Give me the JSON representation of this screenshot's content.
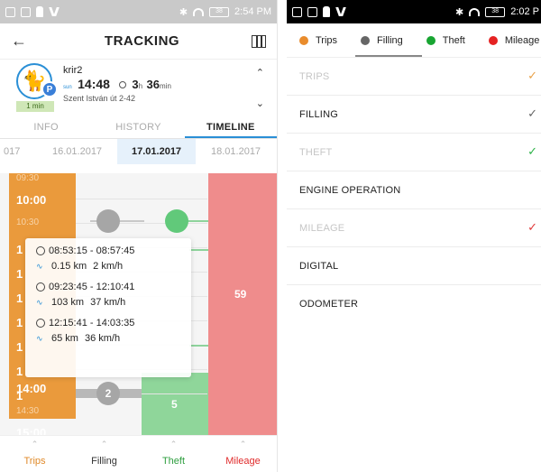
{
  "left": {
    "statusbar": {
      "time": "2:54 PM",
      "battery": "38"
    },
    "header": {
      "title": "TRACKING"
    },
    "vehicle": {
      "name": "krir2",
      "time_prefix": "sun",
      "time": "14:48",
      "duration_h": "3",
      "duration_h_unit": "h",
      "duration_m": "36",
      "duration_m_unit": "min",
      "address": "Szent István út 2-42",
      "badge": "1 min",
      "p_badge": "P"
    },
    "tabs": [
      "INFO",
      "HISTORY",
      "TIMELINE"
    ],
    "dates": [
      "017",
      "16.01.2017",
      "17.01.2017",
      "18.01.2017"
    ],
    "timeline": {
      "hours": [
        "09:30",
        "10:00",
        "10:30",
        "1",
        "1",
        "1",
        "1",
        "1",
        "1",
        "1",
        "14:00",
        "14:30",
        "15:00"
      ],
      "filling_count": "2",
      "theft_count": "5",
      "mileage_count": "59",
      "popup": [
        {
          "time": "08:53:15 - 08:57:45",
          "dist": "0.15 km",
          "speed": "2 km/h"
        },
        {
          "time": "09:23:45 - 12:10:41",
          "dist": "103 km",
          "speed": "37 km/h"
        },
        {
          "time": "12:15:41 - 14:03:35",
          "dist": "65 km",
          "speed": "36 km/h"
        }
      ]
    },
    "bottomnav": [
      {
        "label": "Trips",
        "color": "#e08a2a"
      },
      {
        "label": "Filling",
        "color": "#333333"
      },
      {
        "label": "Theft",
        "color": "#2e9e3f"
      },
      {
        "label": "Mileage",
        "color": "#e02b2b"
      }
    ]
  },
  "right": {
    "statusbar": {
      "time": "2:02 P",
      "battery": "38"
    },
    "filters": [
      {
        "label": "Trips",
        "color": "#e98c2c"
      },
      {
        "label": "Filling",
        "color": "#666666"
      },
      {
        "label": "Theft",
        "color": "#18a532"
      },
      {
        "label": "Mileage",
        "color": "#e52222"
      }
    ],
    "rows": [
      {
        "label": "TRIPS",
        "dim": true,
        "check": "✓",
        "check_color": "#e9a24a"
      },
      {
        "label": "FILLING",
        "dim": false,
        "check": "✓",
        "check_color": "#666666"
      },
      {
        "label": "THEFT",
        "dim": true,
        "check": "✓",
        "check_color": "#2fb34a"
      },
      {
        "label": "ENGINE OPERATION",
        "dim": false,
        "check": "",
        "check_color": "#666666"
      },
      {
        "label": "MILEAGE",
        "dim": true,
        "check": "✓",
        "check_color": "#e03a3a"
      },
      {
        "label": "DIGITAL",
        "dim": false,
        "check": "",
        "check_color": "#666666"
      },
      {
        "label": "ODOMETER",
        "dim": false,
        "check": "",
        "check_color": "#666666"
      }
    ]
  }
}
